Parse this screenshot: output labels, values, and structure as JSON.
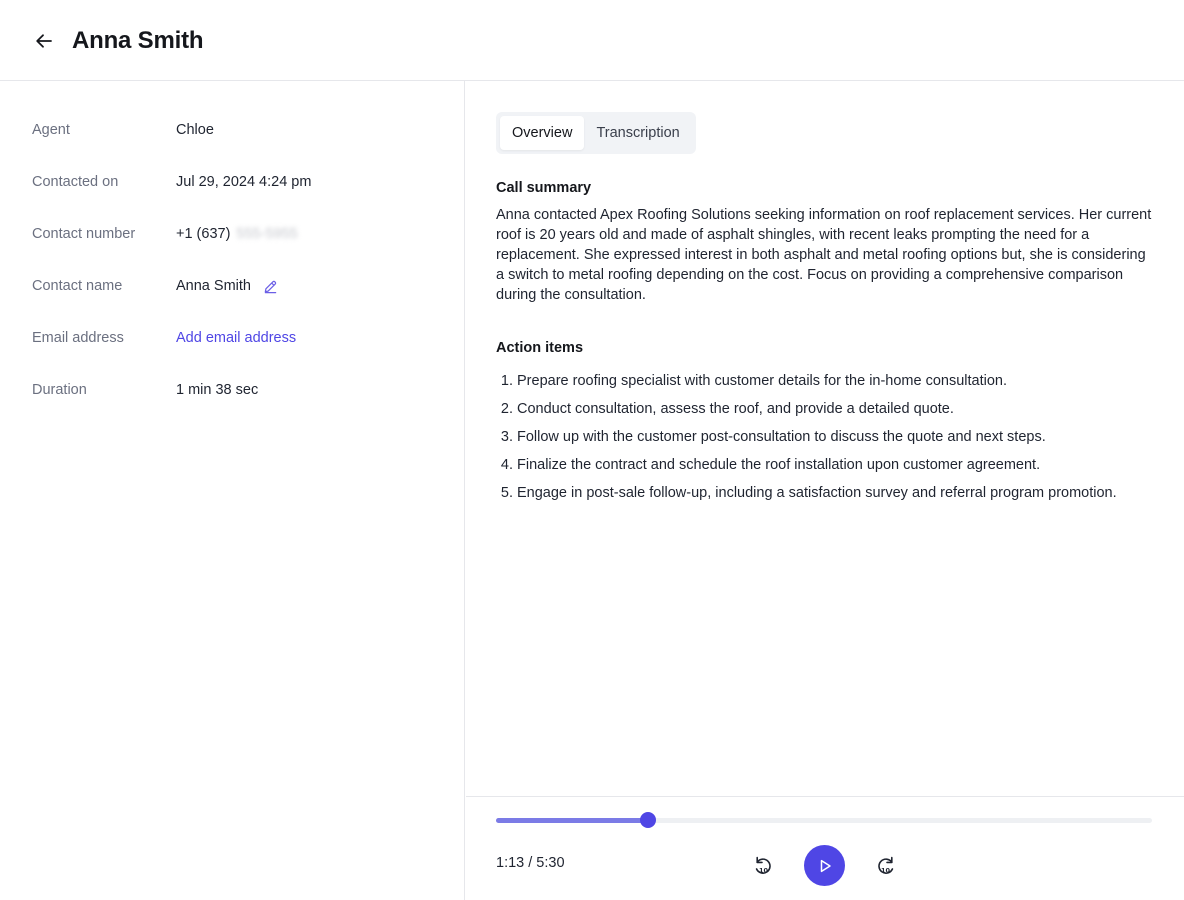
{
  "header": {
    "title": "Anna Smith"
  },
  "details": {
    "agent": {
      "label": "Agent",
      "value": "Chloe"
    },
    "contacted_on": {
      "label": "Contacted on",
      "value": "Jul 29, 2024 4:24 pm"
    },
    "contact_number": {
      "label": "Contact number",
      "value": "+1 (637)",
      "hidden_part": "555-5955"
    },
    "contact_name": {
      "label": "Contact name",
      "value": "Anna Smith"
    },
    "email": {
      "label": "Email address",
      "link": "Add email address"
    },
    "duration": {
      "label": "Duration",
      "value": "1 min 38 sec"
    }
  },
  "tabs": [
    {
      "label": "Overview",
      "active": true
    },
    {
      "label": "Transcription",
      "active": false
    }
  ],
  "overview": {
    "summary_title": "Call summary",
    "summary": "Anna contacted Apex Roofing Solutions seeking information on roof replacement services. Her current roof is 20 years old and made of asphalt shingles, with recent leaks prompting the need for a replacement. She expressed interest in both asphalt and metal roofing options but, she is considering a switch to metal roofing depending on the cost. Focus on providing a comprehensive comparison during the consultation.",
    "actions_title": "Action items",
    "actions": [
      {
        "num": "1.",
        "text": "Prepare roofing specialist with customer details for the in-home consultation."
      },
      {
        "num": "2.",
        "text": "Conduct consultation, assess the roof, and provide a detailed quote."
      },
      {
        "num": "3.",
        "text": "Follow up with the customer post-consultation to discuss the quote and next steps."
      },
      {
        "num": "4.",
        "text": "Finalize the contract and schedule the roof installation upon customer agreement."
      },
      {
        "num": "5.",
        "text": "Engage in post-sale follow-up, including a satisfaction survey and referral program promotion."
      }
    ]
  },
  "player": {
    "readout": "1:13 / 5:30",
    "progress": 0.2317,
    "skip_seconds": "10"
  },
  "colors": {
    "accent": "#4f46e5",
    "track_fill": "#7b7be6",
    "track": "#eef0f3",
    "border": "#e6e7eb",
    "label": "#6b7080"
  },
  "icons": {
    "back": "arrow-left-icon",
    "edit": "pencil-icon",
    "rewind": "rewind-10-icon",
    "play": "play-icon",
    "forward": "forward-10-icon"
  }
}
